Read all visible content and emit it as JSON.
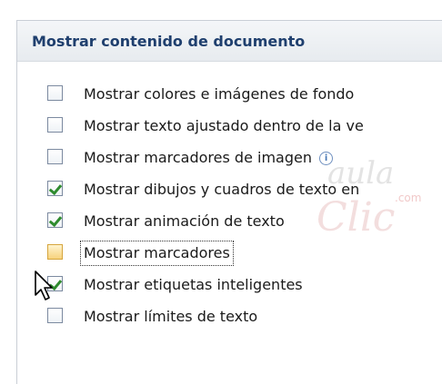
{
  "section": {
    "title": "Mostrar contenido de documento"
  },
  "options": [
    {
      "label": "Mostrar colores e imágenes de fondo",
      "checked": false
    },
    {
      "label": "Mostrar texto ajustado dentro de la ve",
      "checked": false
    },
    {
      "label": "Mostrar marcadores de imagen",
      "checked": false,
      "info_icon": "info-icon"
    },
    {
      "label": "Mostrar dibujos y cuadros de texto en",
      "checked": true
    },
    {
      "label": "Mostrar animación de texto",
      "checked": true
    },
    {
      "label": "Mostrar marcadores",
      "checked": false,
      "state": "hover"
    },
    {
      "label": "Mostrar etiquetas inteligentes",
      "checked": true
    },
    {
      "label": "Mostrar límites de texto",
      "checked": false
    }
  ],
  "watermark": {
    "line1": "aula",
    "line2": "Clic",
    "line3": ".com"
  },
  "cursor": {
    "icon": "arrow-cursor-icon"
  },
  "info_glyph": "i",
  "colors": {
    "section_title": "#1f3f6e",
    "check": "#2e8b2e",
    "hover_box": "#f7d37d"
  }
}
